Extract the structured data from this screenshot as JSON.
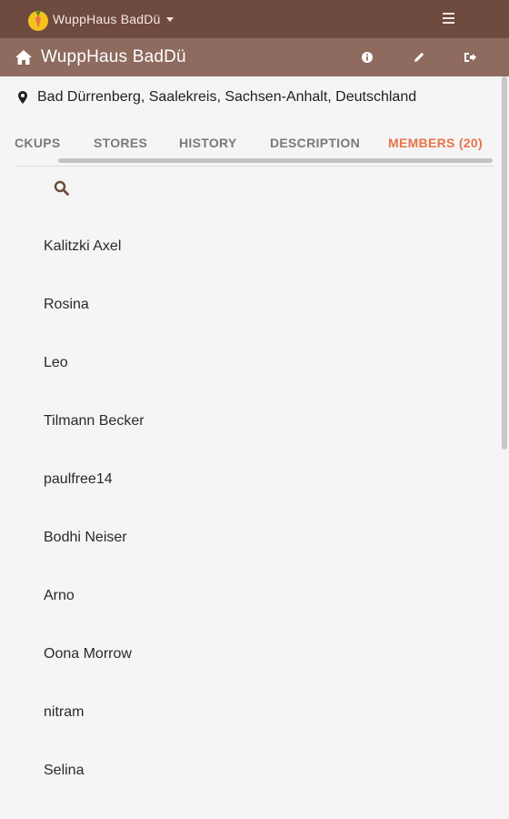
{
  "topbar": {
    "brand_name": "WuppHaus BadDü",
    "brand_icon": "carrot-logo-icon",
    "menu_icon": "hamburger-menu-icon"
  },
  "group_header": {
    "title": "WuppHaus BadDü",
    "icons": [
      "home-icon",
      "info-icon",
      "edit-pencil-icon",
      "leave-signout-icon"
    ]
  },
  "location": {
    "text": "Bad Dürrenberg, Saalekreis, Sachsen-Anhalt, Deutschland",
    "icon": "map-pin-icon"
  },
  "tabs": [
    {
      "label": "CKUPS"
    },
    {
      "label": "STORES"
    },
    {
      "label": "HISTORY"
    },
    {
      "label": "DESCRIPTION"
    },
    {
      "label": "MEMBERS (20)",
      "active": true
    }
  ],
  "search": {
    "icon": "search-icon"
  },
  "members": [
    "Kalitzki Axel",
    "Rosina",
    "Leo",
    "Tilmann Becker",
    "paulfree14",
    "Bodhi Neiser",
    "Arno",
    "Oona Morrow",
    "nitram",
    "Selina"
  ],
  "colors": {
    "topbar": "#6f4a3e",
    "group_header": "#8e6a5f",
    "active_tab": "#e8734a",
    "background": "#f5f5f5"
  }
}
